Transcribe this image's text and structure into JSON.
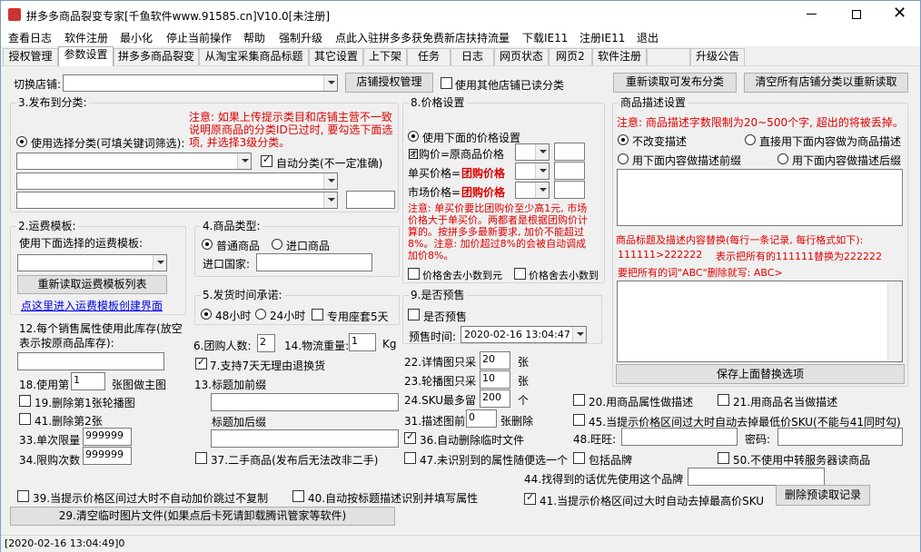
{
  "window": {
    "title": "拼多多商品裂变专家[千鱼软件www.91585.cn]V10.0[未注册]"
  },
  "menu": [
    "查看日志",
    "软件注册",
    "最小化",
    "停止当前操作",
    "帮助",
    "强制升级",
    "点此入驻拼多多获免费新店扶持流量",
    "下载IE11",
    "注册IE11",
    "退出"
  ],
  "tabs": [
    "授权管理",
    "参数设置",
    "拼多多商品裂变",
    "从淘宝采集商品标题",
    "其它设置",
    "上下架",
    "任务",
    "日志",
    "网页状态",
    "网页2",
    "软件注册",
    "",
    "升级公告"
  ],
  "top": {
    "shop_label": "切换店铺:",
    "shop_auth_btn": "店铺授权管理",
    "use_other_shop": "使用其他店铺已读分类",
    "reload_btn": "重新读取可发布分类",
    "clear_btn": "清空所有店铺分类以重新读取"
  },
  "publish": {
    "title": "3.发布到分类:",
    "note": "注意: 如果上传提示类目和店铺主营不一致说明原商品的分类ID已过时, 要勾选下面选项, 并选择3级分类。",
    "radio": "使用选择分类(可填关键词筛选):",
    "auto_cat": "自动分类(不一定准确)"
  },
  "freight": {
    "title": "2.运费模板:",
    "label": "使用下面选择的运费模板:",
    "reload_btn": "重新读取运费模板列表",
    "link": "点这里进入运费模板创建界面"
  },
  "goods_type": {
    "title": "4.商品类型:",
    "normal": "普通商品",
    "import": "进口商品",
    "country": "进口国家:"
  },
  "ship": {
    "title": "5.发货时间承诺:",
    "h48": "48小时",
    "h24": "24小时",
    "special": "专用座套5天"
  },
  "price": {
    "title": "8.价格设置",
    "use": "使用下面的价格设置",
    "group": "团购价=原商品价格",
    "single": "单买价格=",
    "single_val": "团购价格",
    "market": "市场价格=",
    "market_val": "团购价格",
    "note": "注意: 单买价要比团购价至少高1元, 市场价格大于单买价。两都者是根据团购价计算的。按拼多多最新要求, 加价不能超过8%。注意: 加价超过8%的会被自动调成加价8%。",
    "round1": "价格舍去小数到元",
    "round2": "价格舍去小数到"
  },
  "presale": {
    "title": "9.是否预售",
    "check": "是否预售",
    "time_label": "预售时间:",
    "time": "2020-02-16 13:04:47"
  },
  "desc": {
    "title": "商品描述设置",
    "note": "注意: 商品描述字数限制为20~500个字, 超出的将被丢掉。",
    "keep": "不改变描述",
    "direct": "直接用下面内容做为商品描述",
    "prefix": "用下面内容做描述前缀",
    "suffix": "用下面内容做描述后缀",
    "replace_label": "商品标题及描述内容替换(每行一条记录, 每行格式如下):",
    "replace_eg": "111111>222222",
    "replace_eg2": "表示把所有的111111替换为222222",
    "replace_del": "要把所有的词\"ABC\"删除就写: ABC>",
    "save_btn": "保存上面替换选项"
  },
  "opts": {
    "o12": "12.每个销售属性使用此库存(放空表示按原商品库存):",
    "o18a": "18.使用第",
    "o18v": "1",
    "o18b": "张图做主图",
    "o19": "19.删除第1张轮播图",
    "o41": "41.删除第2张",
    "o33": "33.单次限量",
    "o33v": "999999",
    "o34": "34.限购次数",
    "o34v": "999999",
    "o6": "6.团购人数:",
    "o6v": "2",
    "o14": "14.物流重量:",
    "o14v": "1",
    "o14u": "Kg",
    "o7": "7.支持7天无理由退换货",
    "o13": "13.标题加前缀",
    "o13b": "标题加后缀",
    "o37": "37.二手商品(发布后无法改非二手)",
    "o22": "22.详情图只采",
    "o22v": "20",
    "o23": "23.轮播图只采",
    "o23v": "10",
    "o24": "24.SKU最多留",
    "o24v": "200",
    "unit_z": "张",
    "unit_g": "个",
    "o31": "31.描述图前",
    "o31v": "0",
    "o31b": "张删除",
    "o36": "36.自动删除临时文件",
    "o47": "47.未识别到的属性随便选一个",
    "o20": "20.用商品属性做描述",
    "o21": "21.用商品名当做描述",
    "o45": "45.当提示价格区间过大时自动去掉最低价SKU(不能与41同时勾)",
    "o48": "48.旺旺:",
    "pwd": "密码:",
    "brand": "包括品牌",
    "o50": "50.不使用中转服务器读商品",
    "o44": "44.找得到的话优先使用这个品牌",
    "o39": "39.当提示价格区间过大时不自动加价跳过不复制",
    "o40": "40.自动按标题描述识别并填写属性",
    "o41b": "41.当提示价格区间过大时自动去掉最高价SKU",
    "del_presale": "删除预读取记录",
    "o29": "29.清空临时图片文件(如果点后卡死请卸载腾讯管家等软件)"
  },
  "status": "[2020-02-16 13:04:49]0"
}
